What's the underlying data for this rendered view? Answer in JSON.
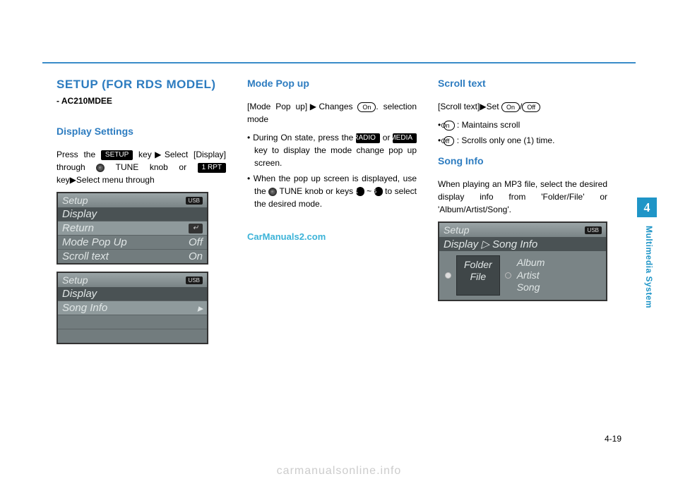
{
  "page": {
    "number": "4-19",
    "chapter_tab": "4",
    "chapter_label": "Multimedia System",
    "bottom_watermark": "carmanualsonline.info",
    "mid_watermark": "CarManuals2.com"
  },
  "col1": {
    "title": "SETUP (FOR RDS MODEL)",
    "subtitle": "- AC210MDEE",
    "h2": "Display Settings",
    "para_parts": {
      "a": "Press the ",
      "k1": "SETUP",
      "b": " key",
      "arrow1": "▶",
      "c": "Select [Display] through ",
      "d": " TUNE knob or ",
      "k2": "1 RPT",
      "e": " key",
      "arrow2": "▶",
      "f": "Select menu through"
    },
    "ss1": {
      "header": "Setup",
      "badge": "USB",
      "section": "Display",
      "row1": "Return",
      "row2l": "Mode Pop Up",
      "row2r": "Off",
      "row3l": "Scroll text",
      "row3r": "On"
    },
    "ss2": {
      "header": "Setup",
      "badge": "USB",
      "section": "Display",
      "row1": "Song Info",
      "row1r": "▸"
    }
  },
  "col2": {
    "h2a": "Mode Pop up",
    "p1": {
      "a": "[Mode Pop up]",
      "arrow": "▶",
      "b": "Changes ",
      "pill": "On",
      "c": ". selection mode"
    },
    "li1": {
      "a": "During On state, press the ",
      "k1": "RADIO",
      "b": " or ",
      "k2": "MEDIA",
      "c": " key to display the mode change pop up screen."
    },
    "li2": {
      "a": "When the pop up screen is displayed, use the ",
      "b": " TUNE knob or keys ",
      "k1": "1",
      "tilde": " ~ ",
      "k2": "6",
      "c": " to select the desired mode."
    }
  },
  "col3": {
    "h2a": "Scroll text",
    "p1": {
      "a": "[Scroll text]",
      "arrow": "▶",
      "b": "Set ",
      "pill1": "On",
      "slash": "/",
      "pill2": "Off"
    },
    "li1": {
      "pill": "On",
      "text": " : Maintains scroll"
    },
    "li2": {
      "pill": "Off",
      "text": " : Scrolls only one (1) time."
    },
    "h2b": "Song Info",
    "p2": "When playing an MP3 file, select the desired display info from 'Folder/File' or 'Album/Artist/Song'.",
    "ss3": {
      "header": "Setup",
      "badge": "USB",
      "section": "Display ▷ Song Info",
      "box1": "Folder",
      "box2": "File",
      "l1": "Album",
      "l2": "Artist",
      "l3": "Song"
    }
  }
}
